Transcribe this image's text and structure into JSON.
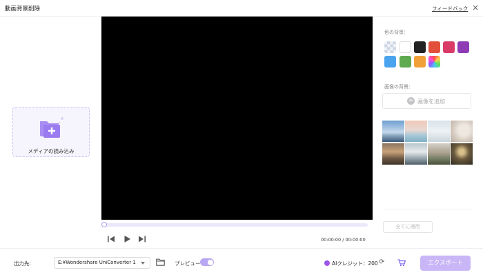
{
  "window": {
    "title": "動画背景削除",
    "feedback_link": "フィードバック",
    "close_glyph": "×"
  },
  "media": {
    "import_label": "メディアの読み込み"
  },
  "player": {
    "time_display": "00:00:00 / 00:00:00",
    "progress": 0
  },
  "right_panel": {
    "color_bg_label": "色の背景：",
    "colors": [
      "transparent",
      "#ffffff",
      "#222222",
      "#e2503c",
      "#d93a66",
      "#8e3bb5",
      "#4aa3ee",
      "#5faa4f",
      "#f2a13a",
      "rainbow"
    ],
    "image_bg_label": "画像の背景：",
    "add_image_label": "画像を追加",
    "apply_all_label": "全てに適用"
  },
  "bottom": {
    "output_label": "出力先:",
    "output_path": "E:¥Wondershare UniConverter 1",
    "preview_label": "プレビュー",
    "preview_on": true,
    "ai_credit": "AIクレジット：200",
    "export_label": "エクスポート"
  },
  "colors": {
    "accent": "#b8a6f3",
    "export_bg": "#c8b6f6",
    "video_bg": "#000000"
  }
}
